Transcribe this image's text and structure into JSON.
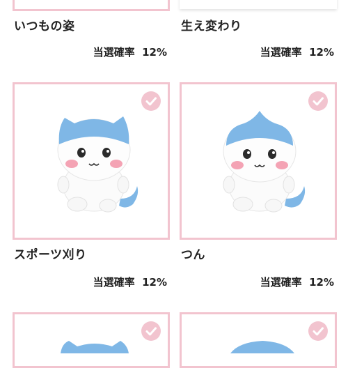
{
  "items": [
    {
      "name": "いつもの姿",
      "probability": "当選確率  12%",
      "selected": false
    },
    {
      "name": "生え変わり",
      "probability": "当選確率  12%",
      "selected": false
    },
    {
      "name": "スポーツ刈り",
      "probability": "当選確率  12%",
      "selected": true
    },
    {
      "name": "つん",
      "probability": "当選確率  12%",
      "selected": true
    },
    {
      "name": "",
      "probability": "",
      "selected": true
    },
    {
      "name": "",
      "probability": "",
      "selected": true
    }
  ],
  "icons": {
    "check": "check-icon",
    "product": "plush-toy-image"
  },
  "colors": {
    "accent": "#f2c4cf",
    "plush_blue": "#7fb7e6",
    "text": "#222222"
  }
}
